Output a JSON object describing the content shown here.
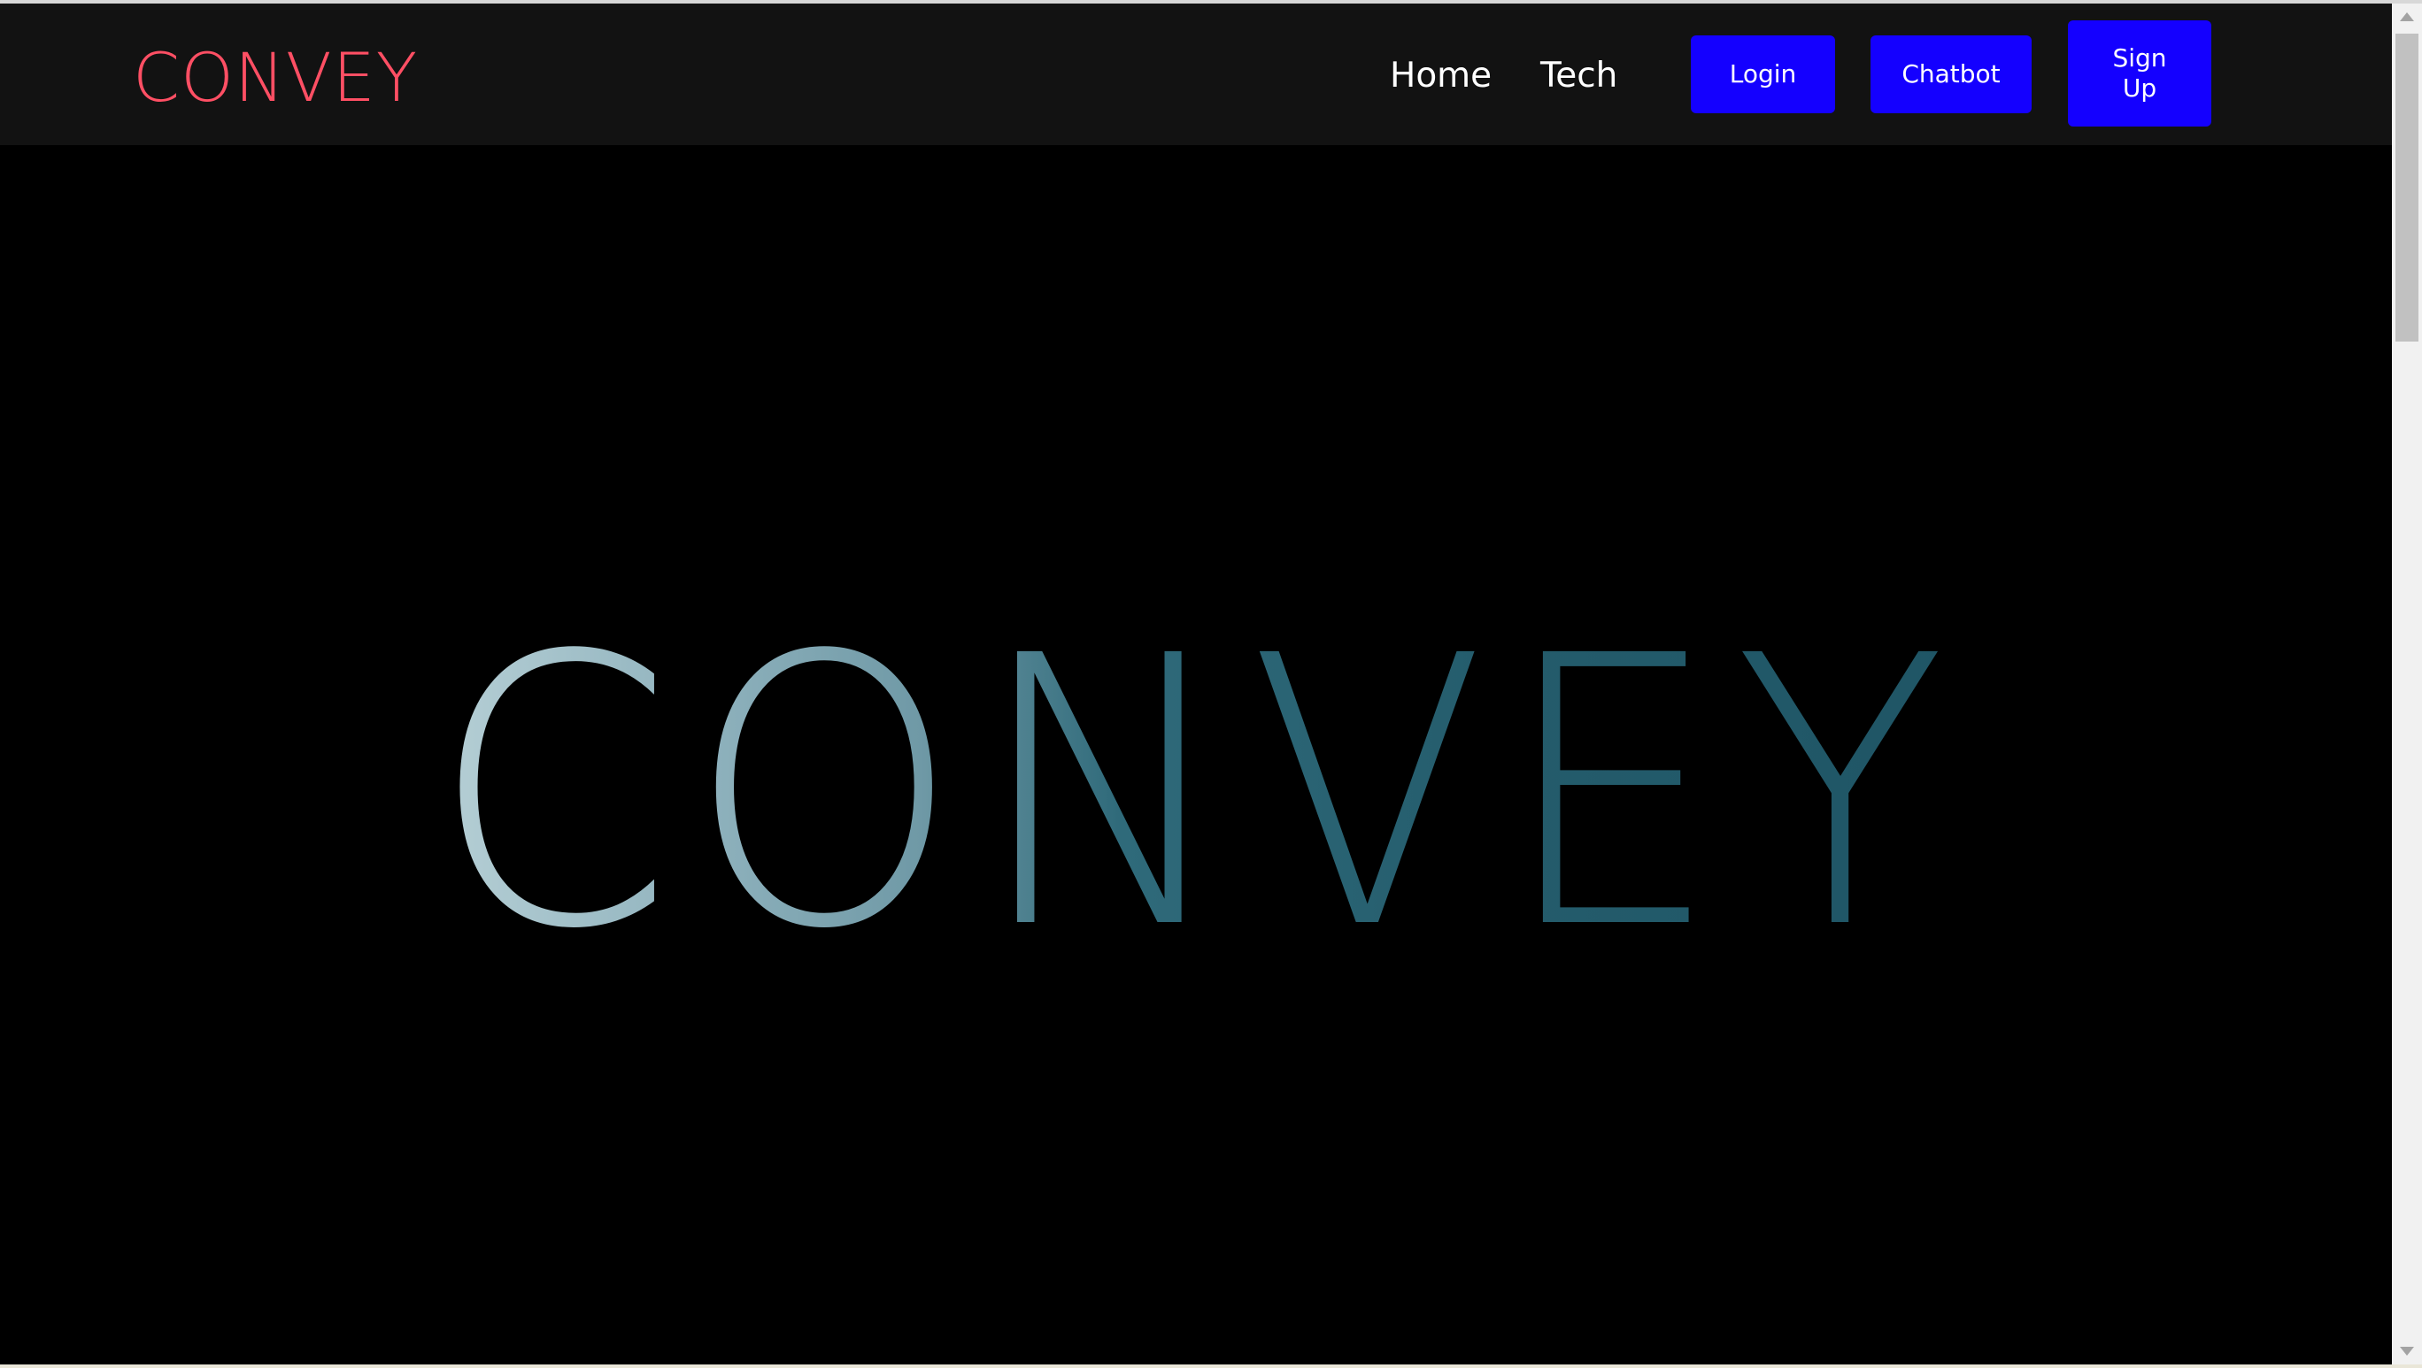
{
  "navbar": {
    "brand": "CONVEY",
    "links": [
      {
        "label": "Home"
      },
      {
        "label": "Tech"
      }
    ],
    "buttons": {
      "login": "Login",
      "chatbot": "Chatbot",
      "signup": "Sign Up"
    }
  },
  "hero": {
    "title": "CONVEY"
  },
  "colors": {
    "navbar_bg": "#121212",
    "brand": "#ff4f64",
    "button_bg": "#1400ff",
    "page_bg": "#000000",
    "hero_text_light": "#a9c6cf",
    "hero_text_dark": "#1d5a6a"
  },
  "icons": {
    "scroll_up": "triangle-up",
    "scroll_down": "triangle-down"
  }
}
